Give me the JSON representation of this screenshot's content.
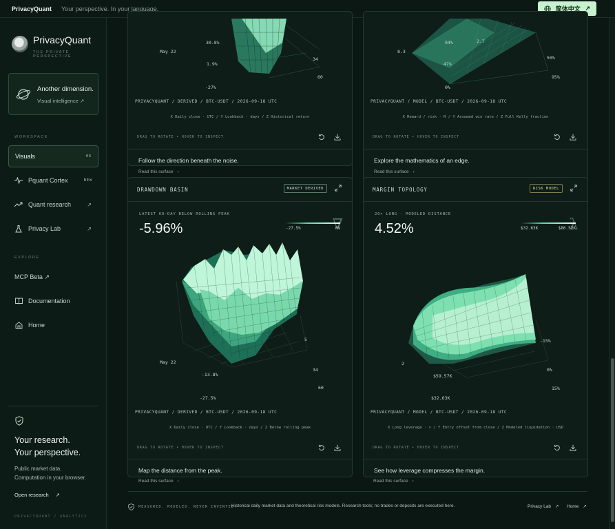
{
  "topbar": {
    "brand": "PrivacyQuant",
    "tagline": "Your perspective. In your language.",
    "lang_label": "简体中文",
    "lang_arrow": "↗"
  },
  "sidebar": {
    "app_name": "PrivacyQuant",
    "app_sub": "THE PRIVATE PERSPECTIVE",
    "card_title": "Another dimension.",
    "card_link": "Visual intelligence ↗",
    "workspace_label": "WORKSPACE",
    "workspace_items": [
      {
        "label": "Visuals",
        "tag": "06",
        "icon": "none"
      },
      {
        "label": "Pquant Cortex",
        "tag": "NEW",
        "icon": "pulse-icon"
      },
      {
        "label": "Quant research",
        "tag": "↗",
        "icon": "trend-icon"
      },
      {
        "label": "Privacy Lab",
        "tag": "↗",
        "icon": "flask-icon"
      }
    ],
    "explore_label": "EXPLORE",
    "explore_items": [
      {
        "label": "MCP Beta ↗",
        "icon": "none"
      },
      {
        "label": "Documentation",
        "icon": "book-icon"
      },
      {
        "label": "Home",
        "icon": "home-icon"
      }
    ],
    "research_line1": "Your research.",
    "research_line2": "Your perspective.",
    "research_p1": "Public market data.",
    "research_p2": "Computation in your browser.",
    "open_research": "Open research",
    "open_research_arrow": "↗",
    "footer": "PRIVACYQUANT / ANALYTICS"
  },
  "cards_top": [
    {
      "labels": [
        "May 22",
        "30.8%",
        "1.9%",
        "-27%",
        "34",
        "60"
      ],
      "meta": "PRIVACYQUANT / DERIVED / BTC-USDT / 2026-09-18 UTC",
      "axes": "X Daily close · UTC / Y Lookback · days / Z Historical return",
      "tools": "DRAG TO ROTATE  •  HOVER TO INSPECT",
      "desc": "Follow the direction beneath the noise.",
      "read": "Read this surface",
      "read_arrow": "›"
    },
    {
      "labels": [
        "8.3",
        "94%",
        "2.7",
        "47%",
        "0%",
        "50%",
        "95%"
      ],
      "meta": "PRIVACYQUANT / MODEL / PRIVACYQUANT / MODEL / BTC-USDT / 2026-09-18 UTC",
      "meta_short": "PRIVACYQUANT / MODEL / BTC-USDT / 2026-09-18 UTC",
      "axes": "X Reward / risk · R / Y Assumed win rate / Z Full Kelly fraction",
      "tools": "DRAG TO ROTATE  •  HOVER TO INSPECT",
      "desc": "Explore the mathematics of an edge.",
      "read": "Read this surface",
      "read_arrow": "›"
    }
  ],
  "cards_bottom": [
    {
      "title": "DRAWDOWN BASIN",
      "badge": "MARKET DERIVED",
      "kicker": "LATEST 60-DAY BELOW ROLLING PEAK",
      "value": "-5.96%",
      "glyph": "∇",
      "scale_min": "-27.5%",
      "scale_max": "0%",
      "labels": [
        "May 22",
        "5",
        "-13.8%",
        "34",
        "-27.5%",
        "60"
      ],
      "meta": "PRIVACYQUANT / DERIVED / BTC-USDT / 2026-09-18 UTC",
      "axes": "X Daily close · UTC / Y Lookback · days / Z Below rolling peak",
      "tools": "DRAG TO ROTATE  •  HOVER TO INSPECT",
      "desc": "Map the distance from the peak.",
      "read": "Read this surface",
      "read_arrow": "›"
    },
    {
      "title": "MARGIN TOPOLOGY",
      "badge": "RISK MODEL",
      "kicker": "20× LONG · MODELED DISTANCE",
      "value": "4.52%",
      "glyph": "λ",
      "scale_min": "$32.63K",
      "scale_max": "$86.52K",
      "labels": [
        "2",
        "-15%",
        "0%",
        "$59.57K",
        "$32.63K",
        "15%"
      ],
      "meta": "PRIVACYQUANT / MODEL / BTC-USDT / 2026-09-18 UTC",
      "axes": "X Long leverage · × / Y Entry offset from close / Z Modeled liquidation · USD",
      "tools": "DRAG TO ROTATE  •  HOVER TO INSPECT",
      "desc": "See how leverage compresses the margin.",
      "read": "Read this surface",
      "read_arrow": "›"
    }
  ],
  "footer": {
    "motto": "MEASURED. MODELED. NEVER INVENTED.",
    "text": "Historical daily market data and theoretical risk models. Research tools; no trades or deposits are executed here.",
    "link1": "Privacy Lab",
    "link2": "Home",
    "arrow": "↗"
  },
  "colors": {
    "accent": "#c8f2cf",
    "surface_light": "#e8fff2",
    "surface_mid": "#5fd5a2",
    "surface_dark": "#1e5a47",
    "background": "#0b1713"
  }
}
